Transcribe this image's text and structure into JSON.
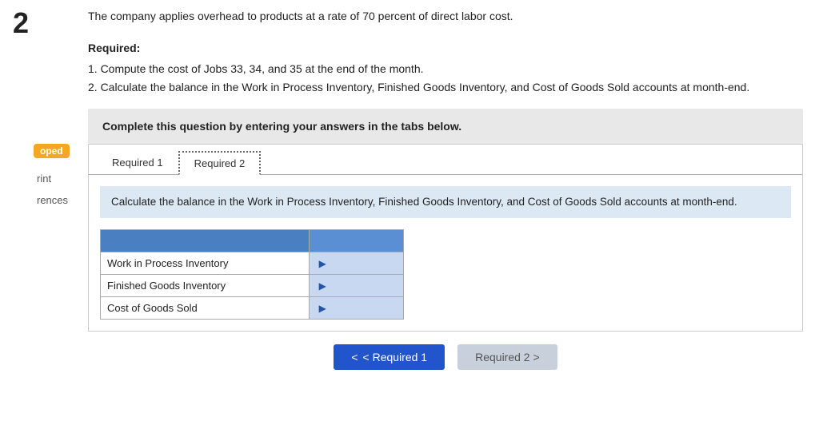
{
  "page": {
    "number": "2",
    "intro": "The company applies overhead to products at a rate of 70 percent of direct labor cost."
  },
  "required_section": {
    "label": "Required:",
    "items": [
      "1. Compute the cost of Jobs 33, 34, and 35 at the end of the month.",
      "2. Calculate the balance in the Work in Process Inventory, Finished Goods Inventory, and Cost of Goods Sold accounts at month-end."
    ]
  },
  "complete_box": {
    "text": "Complete this question by entering your answers in the tabs below."
  },
  "tabs": [
    {
      "id": "req1",
      "label": "Required 1"
    },
    {
      "id": "req2",
      "label": "Required 2"
    }
  ],
  "active_tab": "req2",
  "tab_content": {
    "description": "Calculate the balance in the Work in Process Inventory, Finished Goods Inventory, and Cost of Goods Sold accounts at month-end.",
    "table": {
      "header_label": "",
      "header_value": "",
      "rows": [
        {
          "label": "Work in Process Inventory",
          "value": ""
        },
        {
          "label": "Finished Goods Inventory",
          "value": ""
        },
        {
          "label": "Cost of Goods Sold",
          "value": ""
        }
      ]
    }
  },
  "bottom_nav": {
    "prev_label": "< Required 1",
    "next_label": "Required 2 >"
  },
  "sidebar": {
    "badge": "oped",
    "print": "rint",
    "references": "rences"
  },
  "icons": {
    "arrow_right": "▶",
    "chevron_left": "<",
    "chevron_right": ">"
  }
}
